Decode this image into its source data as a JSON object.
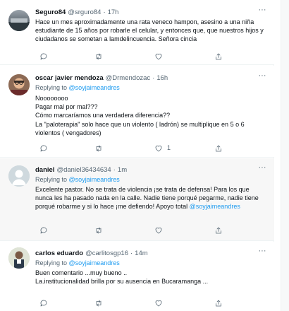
{
  "tweets": [
    {
      "name": "Seguro84",
      "handle": "@srguro84",
      "time": "17h",
      "text": "Hace un mes aproximadamente una rata veneco hampon, asesino a una niña estudiante de 15 años por robarle el celular, y entonces que, que nuestros hijos y ciudadanos se sometan a lamdelincuencia. Señora cincia"
    },
    {
      "name": "oscar javier mendoza",
      "handle": "@Drmendozac",
      "time": "16h",
      "replying_prefix": "Replying to",
      "replying_to": "@soyjaimeandres",
      "text_lines": [
        "Noooooooo",
        "Pagar mal por mal???",
        "Cómo marcaríamos una verdadera diferencia??",
        "La \"paloterapia\" solo hace que un violento ( ladrón) se multiplique en 5 o 6 violentos ( vengadores)"
      ],
      "like_count": "1"
    },
    {
      "name": "daniel",
      "handle": "@daniel36434634",
      "time": "1m",
      "replying_prefix": "Replying to",
      "replying_to": "@soyjaimeandres",
      "text": "Excelente pastor. No se trata de violencia ¡se trata de defensa! Para los que nunca les ha pasado nada en la calle. Nadie tiene porqué pegarme, nadie tiene porqué robarme y si lo hace ¡me defiendo! Apoyo total",
      "trailing_mention": "@soyjaimeandres"
    },
    {
      "name": "carlos eduardo",
      "handle": "@carlitosgp16",
      "time": "14m",
      "replying_prefix": "Replying to",
      "replying_to": "@soyjaimeandres",
      "text_lines": [
        "Buen comentario ...muy bueno ..",
        "La.institucionalidad brilla por su ausencia en Bucaramanga ..."
      ]
    }
  ],
  "icons": {
    "reply": "reply-icon",
    "retweet": "retweet-icon",
    "like": "heart-icon",
    "share": "share-icon",
    "more": "more-icon"
  },
  "colors": {
    "link": "#1d9bf0",
    "muted": "#536471",
    "highlight_bg": "#f7f7f7"
  }
}
